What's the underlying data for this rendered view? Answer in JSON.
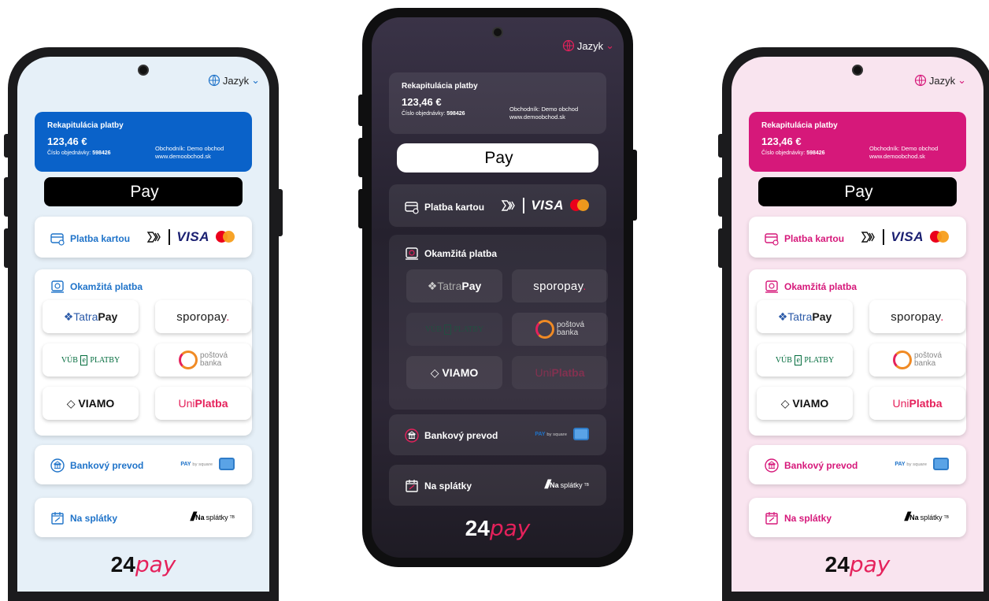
{
  "lang_label": "Jazyk",
  "summary": {
    "title": "Rekapitulácia platby",
    "amount": "123,46 €",
    "order_prefix": "Číslo objednávky:",
    "order_number": "598426",
    "merchant_line": "Obchodník: Demo obchod",
    "merchant_url": "www.demoobchod.sk"
  },
  "apple_pay": {
    "label": "Pay"
  },
  "methods": {
    "card": {
      "label": "Platba kartou",
      "visa": "VISA"
    },
    "instant": {
      "label": "Okamžitá platba",
      "banks": {
        "tatra_a": "Tatra",
        "tatra_b": "Pay",
        "sporo_a": "sporopay",
        "sporo_b": ".",
        "vub_a": "VÚB",
        "vub_e": "e",
        "vub_b": "PLATBY",
        "postova_a": "poštová",
        "postova_b": "banka",
        "viamo": "VIAMO",
        "uni_a": "Uni",
        "uni_b": "Platba"
      }
    },
    "transfer": {
      "label": "Bankový prevod",
      "pbs_a": "PAY",
      "pbs_b": "by square"
    },
    "installments": {
      "label": "Na splátky",
      "brand_a": "Na",
      "brand_b": "splátky",
      "brand_tm": "TB"
    }
  },
  "footer_logo": {
    "num": "24",
    "word": "pay"
  },
  "themes": {
    "blue": {
      "accent": "#1f73c9",
      "bg": "#e6f0f8",
      "summary_bg": "#0a62c9"
    },
    "dark": {
      "accent": "#ffffff",
      "bg": "#2a2434",
      "summary_bg": "#3a3440"
    },
    "pink": {
      "accent": "#d6187a",
      "bg": "#f9e4ef",
      "summary_bg": "#d6187a"
    }
  }
}
